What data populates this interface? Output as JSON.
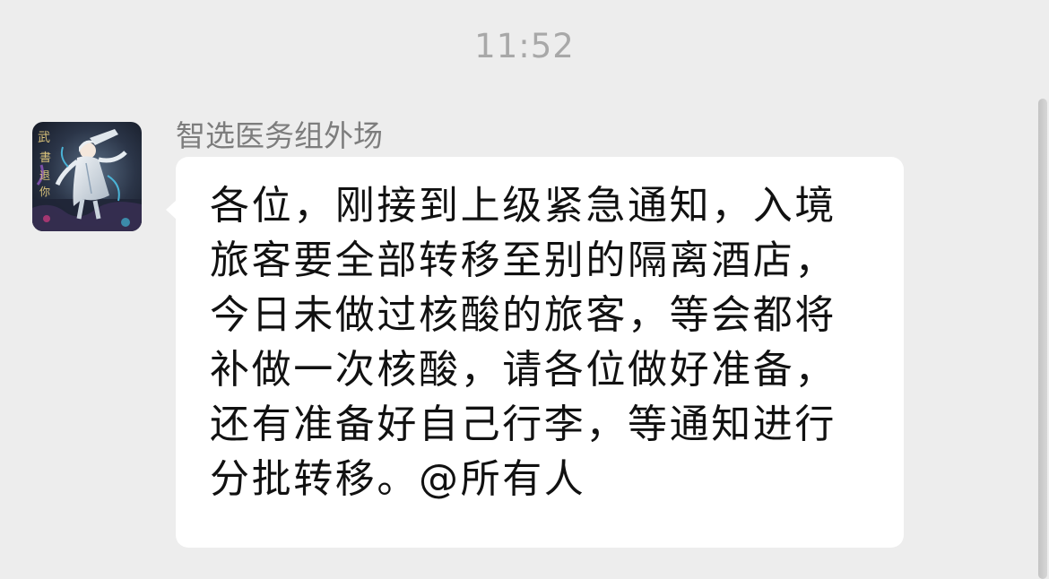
{
  "chat": {
    "timestamp": "11:52",
    "message": {
      "sender_name": "智选医务组外场",
      "avatar_icon": "anime-character-avatar",
      "text": "各位，刚接到上级紧急通知，入境旅客要全部转移至别的隔离酒店，今日未做过核酸的旅客，等会都将补做一次核酸，请各位做好准备，还有准备好自己行李，等通知进行分批转移。@所有人"
    }
  },
  "colors": {
    "background": "#ededed",
    "bubble": "#ffffff",
    "timestamp": "#a8a8a8",
    "sender_name": "#7d7d7d",
    "message_text": "#111111"
  }
}
